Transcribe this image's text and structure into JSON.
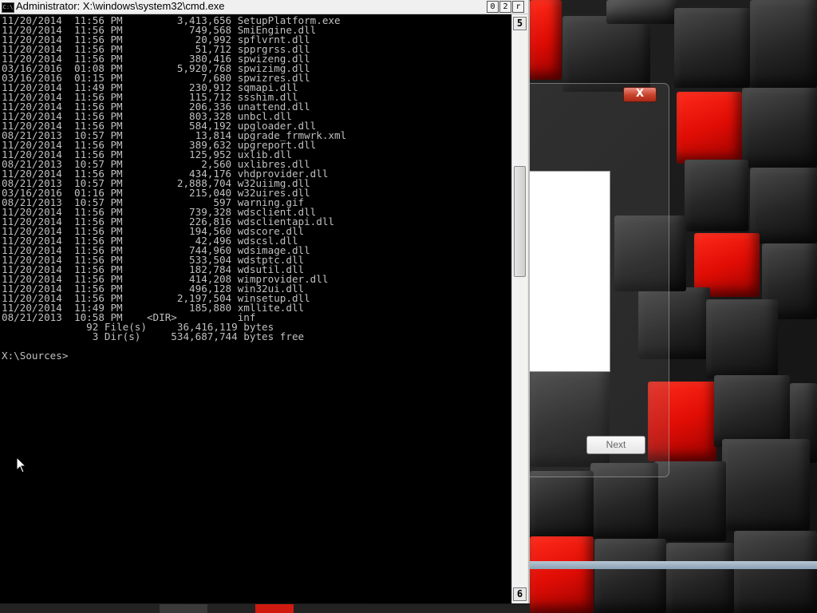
{
  "window": {
    "title": "Administrator: X:\\windows\\system32\\cmd.exe",
    "icon_text": "C:\\",
    "minimize_glyph": "0",
    "maximize_glyph": "2",
    "close_glyph": "r",
    "scroll_up_glyph": "5",
    "scroll_down_glyph": "6"
  },
  "console": {
    "lines": [
      "11/20/2014  11:56 PM         3,413,656 SetupPlatform.exe",
      "11/20/2014  11:56 PM           749,568 SmiEngine.dll",
      "11/20/2014  11:56 PM            20,992 spflvrnt.dll",
      "11/20/2014  11:56 PM            51,712 spprgrss.dll",
      "11/20/2014  11:56 PM           380,416 spwizeng.dll",
      "03/16/2016  01:08 PM         5,920,768 spwizimg.dll",
      "03/16/2016  01:15 PM             7,680 spwizres.dll",
      "11/20/2014  11:49 PM           230,912 sqmapi.dll",
      "11/20/2014  11:56 PM           115,712 ssshim.dll",
      "11/20/2014  11:56 PM           206,336 unattend.dll",
      "11/20/2014  11:56 PM           803,328 unbcl.dll",
      "11/20/2014  11:56 PM           584,192 upgloader.dll",
      "08/21/2013  10:57 PM            13,814 upgrade_frmwrk.xml",
      "11/20/2014  11:56 PM           389,632 upgreport.dll",
      "11/20/2014  11:56 PM           125,952 uxlib.dll",
      "08/21/2013  10:57 PM             2,560 uxlibres.dll",
      "11/20/2014  11:56 PM           434,176 vhdprovider.dll",
      "08/21/2013  10:57 PM         2,888,704 w32uiimg.dll",
      "03/16/2016  01:16 PM           215,040 w32uires.dll",
      "08/21/2013  10:57 PM               597 warning.gif",
      "11/20/2014  11:56 PM           739,328 wdsclient.dll",
      "11/20/2014  11:56 PM           226,816 wdsclientapi.dll",
      "11/20/2014  11:56 PM           194,560 wdscore.dll",
      "11/20/2014  11:56 PM            42,496 wdscsl.dll",
      "11/20/2014  11:56 PM           744,960 wdsimage.dll",
      "11/20/2014  11:56 PM           533,504 wdstptc.dll",
      "11/20/2014  11:56 PM           182,784 wdsutil.dll",
      "11/20/2014  11:56 PM           414,208 wimprovider.dll",
      "11/20/2014  11:56 PM           496,128 win32ui.dll",
      "11/20/2014  11:56 PM         2,197,504 winsetup.dll",
      "11/20/2014  11:49 PM           185,880 xmllite.dll",
      "08/21/2013  10:58 PM    <DIR>          inf",
      "              92 File(s)     36,416,119 bytes",
      "               3 Dir(s)     534,687,744 bytes free",
      "",
      "X:\\Sources>"
    ]
  },
  "setup_dialog": {
    "close_glyph": "X",
    "next_label": "Next"
  },
  "colors": {
    "console_bg": "#000000",
    "console_fg": "#c0c0c0",
    "accent_red": "#e00d05"
  }
}
